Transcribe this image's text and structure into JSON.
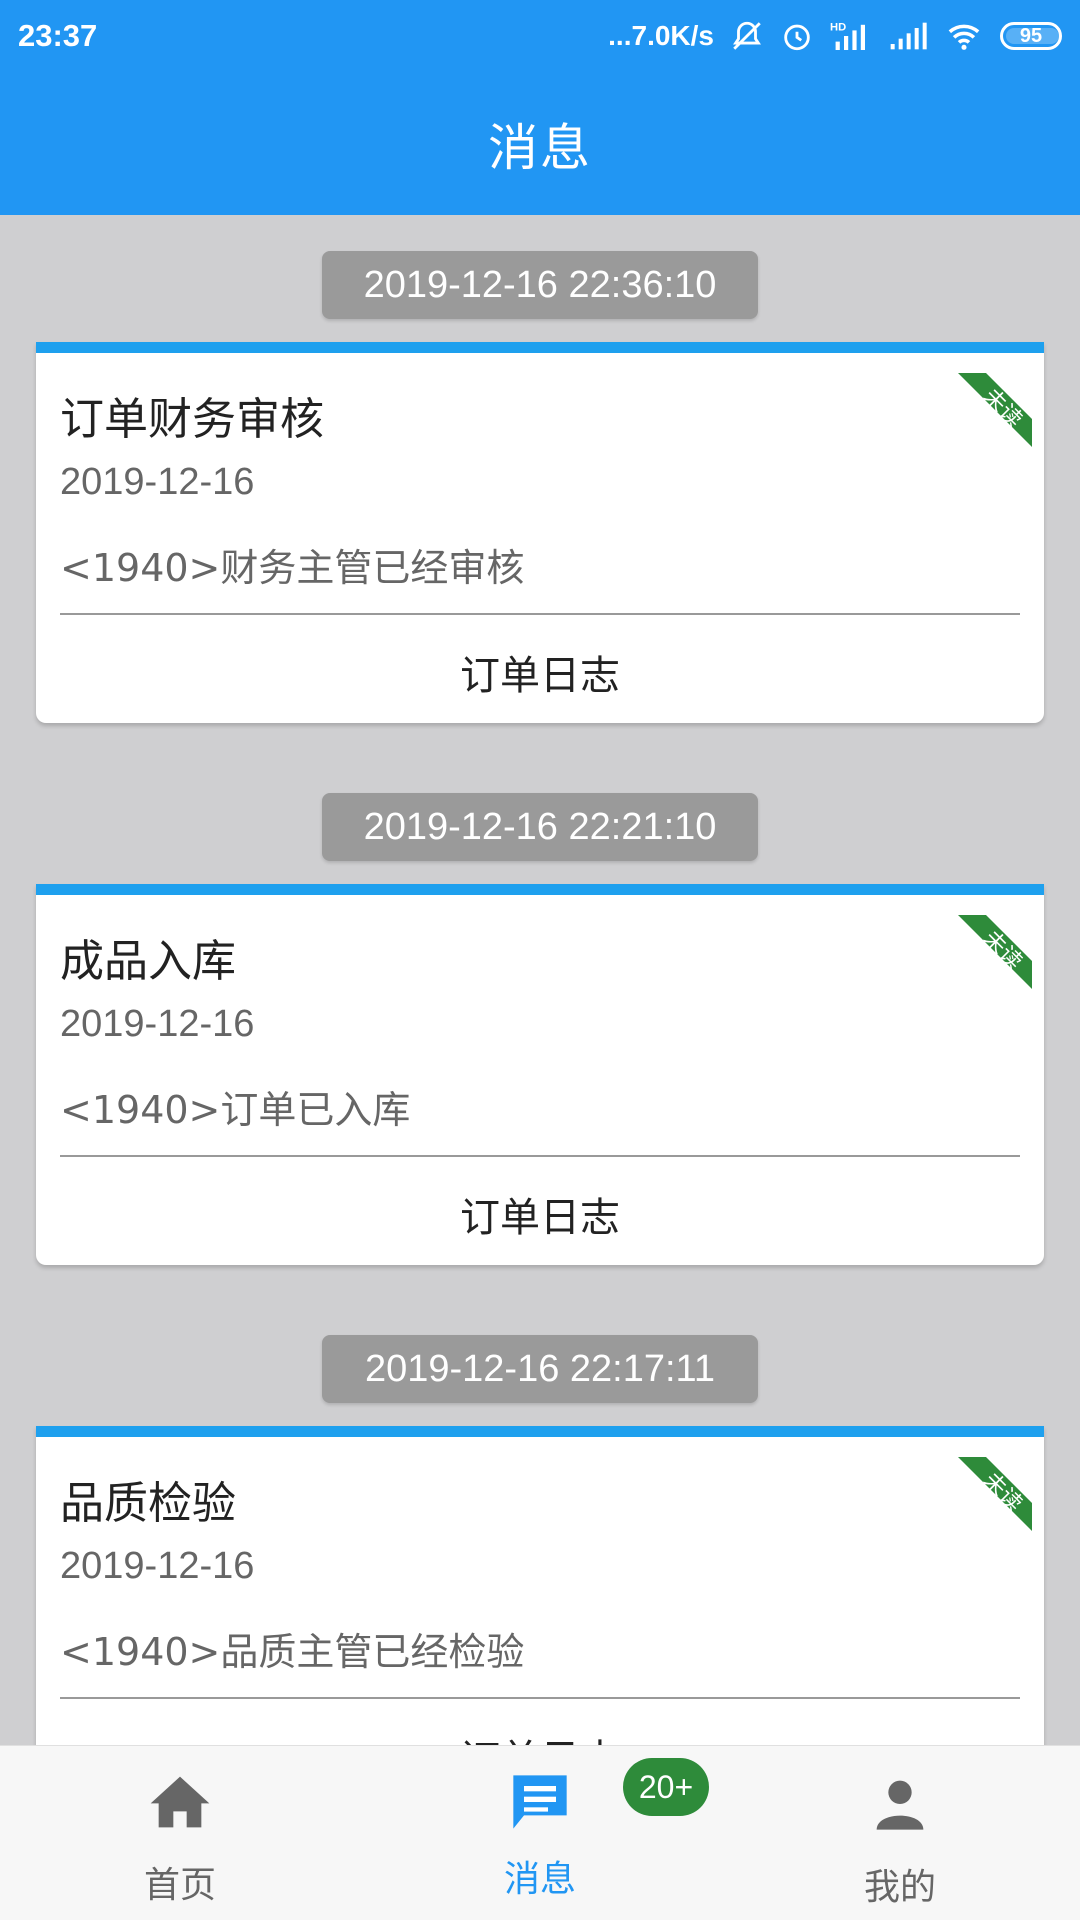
{
  "status_bar": {
    "time": "23:37",
    "network_speed": "...7.0K/s",
    "battery": "95"
  },
  "header": {
    "title": "消息"
  },
  "messages": [
    {
      "timestamp": "2019-12-16 22:36:10",
      "title": "订单财务审核",
      "date": "2019-12-16",
      "description": "<1940>财务主管已经审核",
      "action": "订单日志",
      "status": "未读"
    },
    {
      "timestamp": "2019-12-16 22:21:10",
      "title": "成品入库",
      "date": "2019-12-16",
      "description": "<1940>订单已入库",
      "action": "订单日志",
      "status": "未读"
    },
    {
      "timestamp": "2019-12-16 22:17:11",
      "title": "品质检验",
      "date": "2019-12-16",
      "description": "<1940>品质主管已经检验",
      "action": "订单日志",
      "status": "未读"
    }
  ],
  "bottom_nav": {
    "items": [
      {
        "label": "首页",
        "icon": "home-icon",
        "active": false
      },
      {
        "label": "消息",
        "icon": "message-icon",
        "active": true
      },
      {
        "label": "我的",
        "icon": "person-icon",
        "active": false
      }
    ],
    "message_badge": "20+"
  },
  "colors": {
    "primary": "#2196f3",
    "card_accent": "#1ea0ee",
    "ribbon": "#2e8b3a",
    "badge": "#2e8b3a",
    "background": "#cfcfd1",
    "nav_inactive": "#666666"
  }
}
